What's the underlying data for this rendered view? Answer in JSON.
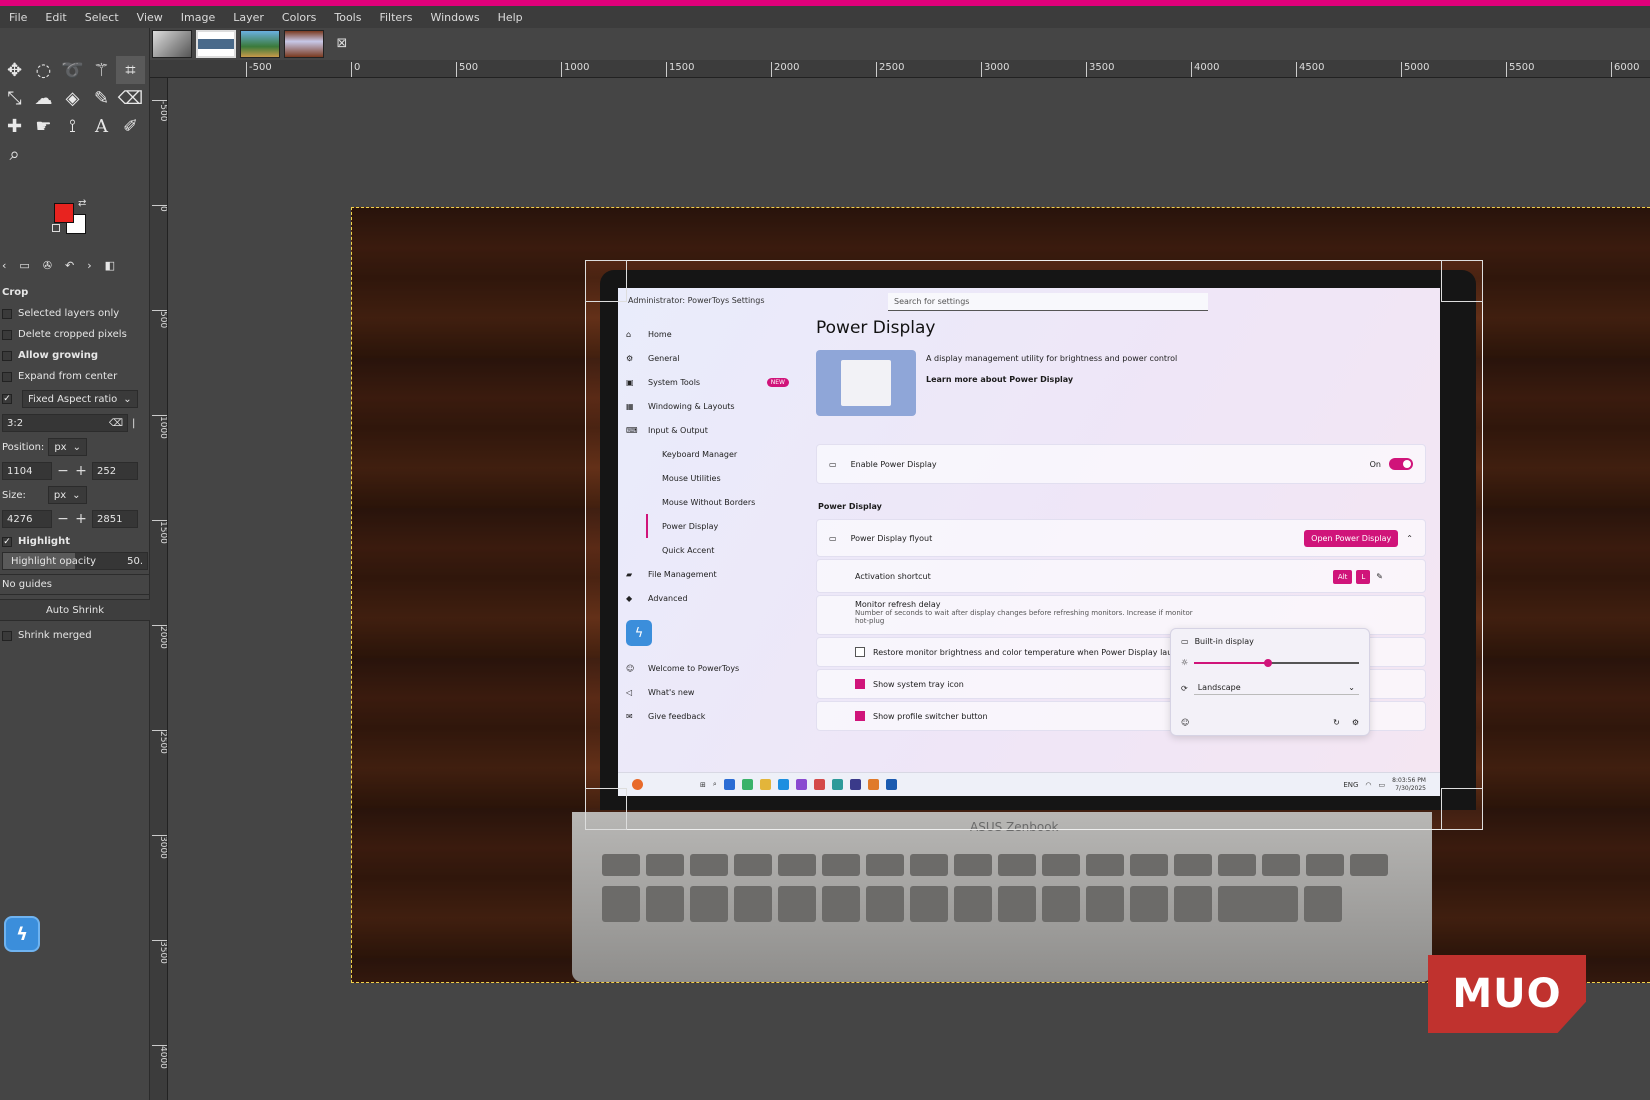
{
  "menubar": [
    "File",
    "Edit",
    "Select",
    "View",
    "Image",
    "Layer",
    "Colors",
    "Tools",
    "Filters",
    "Windows",
    "Help"
  ],
  "colors": {
    "accent_bar": "#e0007a",
    "foreground": "#e8231f",
    "background": "#ffffff",
    "powertoys_pink": "#d0147a"
  },
  "ruler": {
    "h_labels": [
      "-500",
      "0",
      "500",
      "1000",
      "1500",
      "2000",
      "2500",
      "3000",
      "3500",
      "4000",
      "4500",
      "5000",
      "5500",
      "6000"
    ],
    "v_labels": [
      "-500",
      "0",
      "500",
      "1000",
      "1500",
      "2000",
      "2500",
      "3000",
      "3500",
      "4000"
    ]
  },
  "tool_options": {
    "title": "Crop",
    "selected_layers_only": "Selected layers only",
    "delete_cropped_pixels": "Delete cropped pixels",
    "allow_growing": "Allow growing",
    "expand_from_center": "Expand from center",
    "fixed_label": "Fixed Aspect ratio",
    "aspect_value": "3:2",
    "position_label": "Position:",
    "position_unit": "px",
    "position_x": "1104",
    "position_y": "252",
    "size_label": "Size:",
    "size_unit": "px",
    "size_w": "4276",
    "size_h": "2851",
    "highlight": "Highlight",
    "highlight_opacity_label": "Highlight opacity",
    "highlight_opacity_value": "50.",
    "guides": "No guides",
    "auto_shrink": "Auto Shrink",
    "shrink_merged": "Shrink merged"
  },
  "powertoys": {
    "window_title": "Administrator: PowerToys Settings",
    "search_placeholder": "Search for settings",
    "nav": {
      "home": "Home",
      "general": "General",
      "system_tools": "System Tools",
      "new_badge": "NEW",
      "windowing": "Windowing & Layouts",
      "input_output": "Input & Output",
      "keyboard_manager": "Keyboard Manager",
      "mouse_utilities": "Mouse Utilities",
      "mouse_without_borders": "Mouse Without Borders",
      "power_display": "Power Display",
      "quick_accent": "Quick Accent",
      "file_management": "File Management",
      "advanced": "Advanced",
      "welcome": "Welcome to PowerToys",
      "whats_new": "What's new",
      "give_feedback": "Give feedback"
    },
    "page_title": "Power Display",
    "description": "A display management utility for brightness and power control",
    "learn_more": "Learn more about Power Display",
    "enable_label": "Enable Power Display",
    "enable_state": "On",
    "section_title": "Power Display",
    "flyout_label": "Power Display flyout",
    "open_button": "Open Power Display",
    "activation_label": "Activation shortcut",
    "shortcut_keys": [
      "Alt",
      "L"
    ],
    "refresh_label": "Monitor refresh delay",
    "refresh_desc": "Number of seconds to wait after display changes before refreshing monitors. Increase if monitor",
    "refresh_desc2": "hot-plug",
    "restore_label": "Restore monitor brightness and color temperature when Power Display launche",
    "tray_label": "Show system tray icon",
    "switcher_label": "Show profile switcher button",
    "flyout_display": "Built-in display",
    "flyout_orientation": "Landscape",
    "brightness": 0.45,
    "taskbar_time": "8:03:56 PM",
    "taskbar_date": "7/30/2025",
    "taskbar_lang": "ENG"
  },
  "laptop_brand": "ASUS Zenbook",
  "watermark": "MUO"
}
